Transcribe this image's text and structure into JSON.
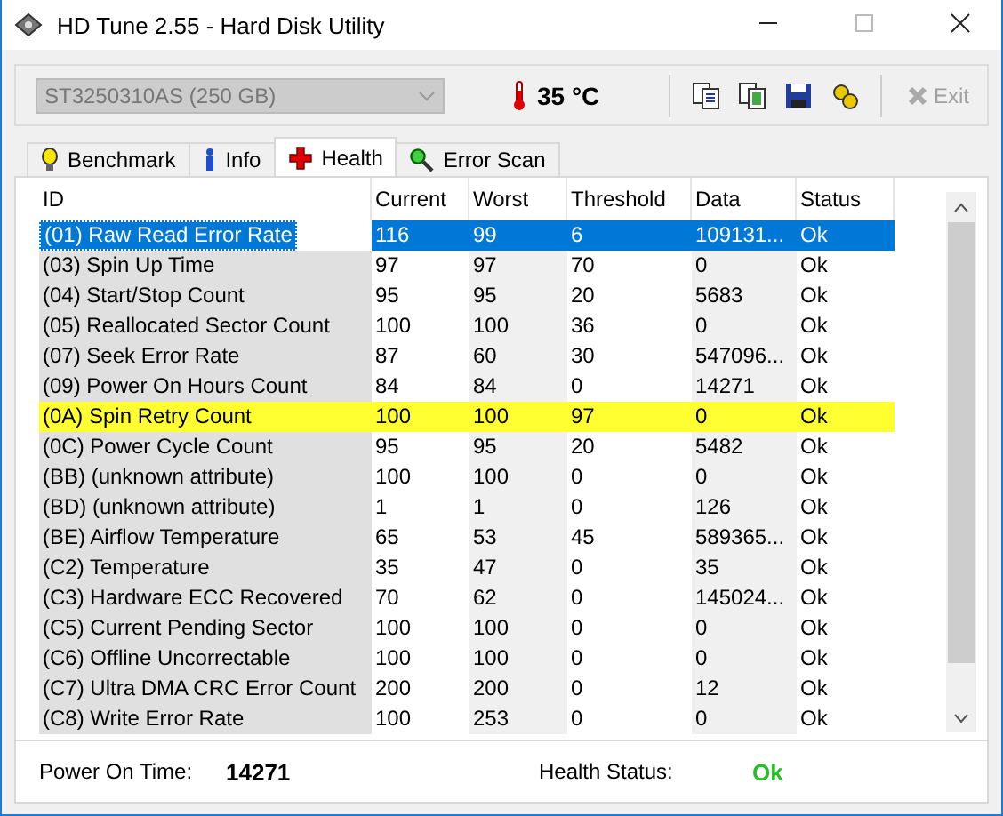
{
  "window": {
    "title": "HD Tune 2.55 - Hard Disk Utility"
  },
  "toolbar": {
    "drive": "ST3250310AS (250 GB)",
    "temperature": "35 °C",
    "exit_label": "Exit",
    "exit_disabled": true
  },
  "tabs": [
    {
      "label": "Benchmark",
      "selected": false
    },
    {
      "label": "Info",
      "selected": false
    },
    {
      "label": "Health",
      "selected": true
    },
    {
      "label": "Error Scan",
      "selected": false
    }
  ],
  "table": {
    "columns": [
      "ID",
      "Current",
      "Worst",
      "Threshold",
      "Data",
      "Status"
    ],
    "rows": [
      {
        "cells": [
          "(01) Raw Read Error Rate",
          "116",
          "99",
          "6",
          "109131...",
          "Ok"
        ],
        "selected": true,
        "warning": false
      },
      {
        "cells": [
          "(03) Spin Up Time",
          "97",
          "97",
          "70",
          "0",
          "Ok"
        ],
        "selected": false,
        "warning": false
      },
      {
        "cells": [
          "(04) Start/Stop Count",
          "95",
          "95",
          "20",
          "5683",
          "Ok"
        ],
        "selected": false,
        "warning": false
      },
      {
        "cells": [
          "(05) Reallocated Sector Count",
          "100",
          "100",
          "36",
          "0",
          "Ok"
        ],
        "selected": false,
        "warning": false
      },
      {
        "cells": [
          "(07) Seek Error Rate",
          "87",
          "60",
          "30",
          "547096...",
          "Ok"
        ],
        "selected": false,
        "warning": false
      },
      {
        "cells": [
          "(09) Power On Hours Count",
          "84",
          "84",
          "0",
          "14271",
          "Ok"
        ],
        "selected": false,
        "warning": false
      },
      {
        "cells": [
          "(0A) Spin Retry Count",
          "100",
          "100",
          "97",
          "0",
          "Ok"
        ],
        "selected": false,
        "warning": true
      },
      {
        "cells": [
          "(0C) Power Cycle Count",
          "95",
          "95",
          "20",
          "5482",
          "Ok"
        ],
        "selected": false,
        "warning": false
      },
      {
        "cells": [
          "(BB) (unknown attribute)",
          "100",
          "100",
          "0",
          "0",
          "Ok"
        ],
        "selected": false,
        "warning": false
      },
      {
        "cells": [
          "(BD) (unknown attribute)",
          "1",
          "1",
          "0",
          "126",
          "Ok"
        ],
        "selected": false,
        "warning": false
      },
      {
        "cells": [
          "(BE) Airflow Temperature",
          "65",
          "53",
          "45",
          "589365...",
          "Ok"
        ],
        "selected": false,
        "warning": false
      },
      {
        "cells": [
          "(C2) Temperature",
          "35",
          "47",
          "0",
          "35",
          "Ok"
        ],
        "selected": false,
        "warning": false
      },
      {
        "cells": [
          "(C3) Hardware ECC Recovered",
          "70",
          "62",
          "0",
          "145024...",
          "Ok"
        ],
        "selected": false,
        "warning": false
      },
      {
        "cells": [
          "(C5) Current Pending Sector",
          "100",
          "100",
          "0",
          "0",
          "Ok"
        ],
        "selected": false,
        "warning": false
      },
      {
        "cells": [
          "(C6) Offline Uncorrectable",
          "100",
          "100",
          "0",
          "0",
          "Ok"
        ],
        "selected": false,
        "warning": false
      },
      {
        "cells": [
          "(C7) Ultra DMA CRC Error Count",
          "200",
          "200",
          "0",
          "12",
          "Ok"
        ],
        "selected": false,
        "warning": false
      },
      {
        "cells": [
          "(C8) Write Error Rate",
          "100",
          "253",
          "0",
          "0",
          "Ok"
        ],
        "selected": false,
        "warning": false
      }
    ]
  },
  "footer": {
    "power_on_label": "Power On Time:",
    "power_on_value": "14271",
    "health_label": "Health Status:",
    "health_value": "Ok"
  }
}
